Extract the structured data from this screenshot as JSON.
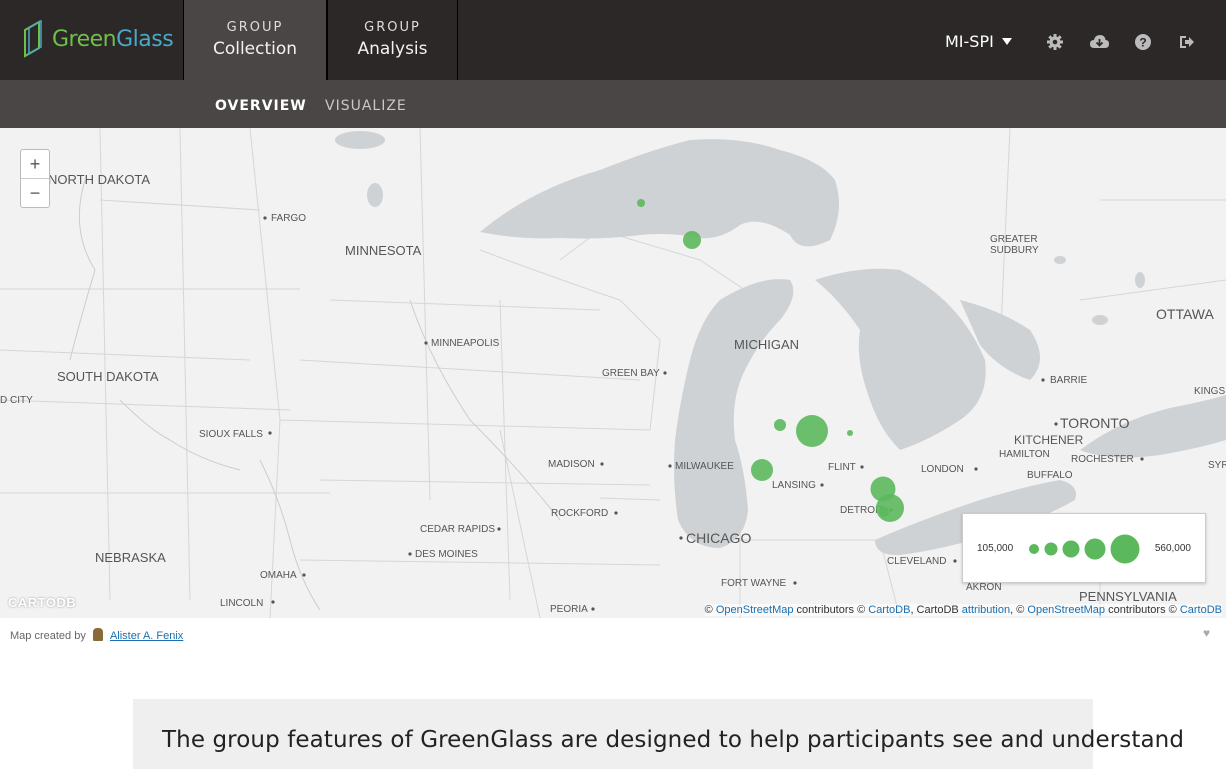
{
  "brand": {
    "name_part1": "Green",
    "name_part2": "Glass"
  },
  "nav": {
    "tabs": [
      {
        "line1": "GROUP",
        "line2": "Collection",
        "active": true
      },
      {
        "line1": "GROUP",
        "line2": "Analysis",
        "active": false
      }
    ],
    "user": "MI-SPI",
    "icons": [
      "gear-icon",
      "cloud-download-icon",
      "help-icon",
      "logout-icon"
    ]
  },
  "subnav": {
    "items": [
      "OVERVIEW",
      "VISUALIZE"
    ],
    "active": "OVERVIEW"
  },
  "map": {
    "zoom_in": "+",
    "zoom_out": "−",
    "labels": {
      "north_dakota": "NORTH DAKOTA",
      "fargo": "FARGO",
      "minnesota": "MINNESOTA",
      "minneapolis": "MINNEAPOLIS",
      "south_dakota": "SOUTH DAKOTA",
      "d_city": "D CITY",
      "sioux_falls": "SIOUX FALLS",
      "nebraska": "NEBRASKA",
      "omaha": "OMAHA",
      "lincoln": "LINCOLN",
      "cedar_rapids": "CEDAR RAPIDS",
      "des_moines": "DES MOINES",
      "rockford": "ROCKFORD",
      "madison": "MADISON",
      "milwaukee": "MILWAUKEE",
      "green_bay": "GREEN BAY",
      "chicago": "CHICAGO",
      "peoria": "PEORIA",
      "fort_wayne": "FORT WAYNE",
      "michigan": "MICHIGAN",
      "lansing": "LANSING",
      "flint": "FLINT",
      "detroit": "DETROIT",
      "cleveland": "CLEVELAND",
      "akron": "AKRON",
      "pennsylvania": "PENNSYLVANIA",
      "london": "LONDON",
      "kitchener": "KITCHENER",
      "hamilton": "HAMILTON",
      "toronto": "TORONTO",
      "buffalo": "BUFFALO",
      "rochester": "ROCHESTER",
      "syr": "SYR",
      "barrie": "BARRIE",
      "kings": "KINGS",
      "ottawa": "OTTAWA",
      "greater": "GREATER",
      "sudbury": "SUDBURY"
    },
    "legend": {
      "min": "105,000",
      "max": "560,000"
    },
    "attribution": {
      "sym1": "©",
      "osm1": "OpenStreetMap",
      "t1": "contributors ©",
      "cartodb1": "CartoDB",
      "t2": ", CartoDB",
      "attr": "attribution",
      "t3": ", ©",
      "osm2": "OpenStreetMap",
      "t4": "contributors ©",
      "cartodb2": "CartoDB"
    },
    "powered_by": "CARTODB",
    "bubble_color": "#5cb85c"
  },
  "credit": {
    "prefix": "Map created by",
    "author": "Alister A. Fenix"
  },
  "intro": {
    "text": "The group features of GreenGlass are designed to help participants see and understand"
  }
}
